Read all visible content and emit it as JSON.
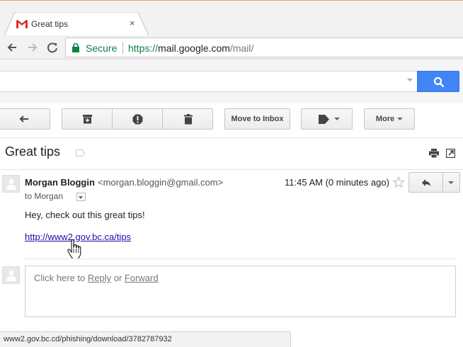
{
  "browser": {
    "tab_title": "Great tips",
    "tab_close": "×",
    "secure_label": "Secure",
    "url_scheme": "https://",
    "url_host": "mail.google.com",
    "url_path": "/mail/"
  },
  "search": {
    "value": "",
    "placeholder": ""
  },
  "toolbar": {
    "move_to_inbox": "Move to Inbox",
    "more": "More"
  },
  "email": {
    "subject": "Great tips",
    "sender_name": "Morgan Bloggin",
    "sender_email": "<morgan.bloggin@gmail.com>",
    "time": "11:45 AM (0 minutes ago)",
    "to_line": "to Morgan",
    "body": "Hey, check out this great tips!",
    "link_text": "http://www2.gov.bc.ca/tips"
  },
  "reply_box": {
    "prefix": "Click here to ",
    "reply": "Reply",
    "or": " or ",
    "forward": "Forward"
  },
  "status": {
    "hover_url": "www2.gov.bc.cd/phishing/download/3782787932"
  },
  "colors": {
    "accent_blue": "#4285f4",
    "secure_green": "#0b8043",
    "link": "#1a0dab",
    "gmail_red": "#d93025"
  },
  "icons": [
    "gmail-logo-icon",
    "back-arrow-icon",
    "forward-arrow-icon",
    "reload-icon",
    "lock-icon",
    "search-icon",
    "reply-icon",
    "archive-icon",
    "spam-icon",
    "trash-icon",
    "label-icon",
    "print-icon",
    "new-window-icon",
    "star-icon",
    "avatar-icon",
    "hand-cursor-icon"
  ]
}
